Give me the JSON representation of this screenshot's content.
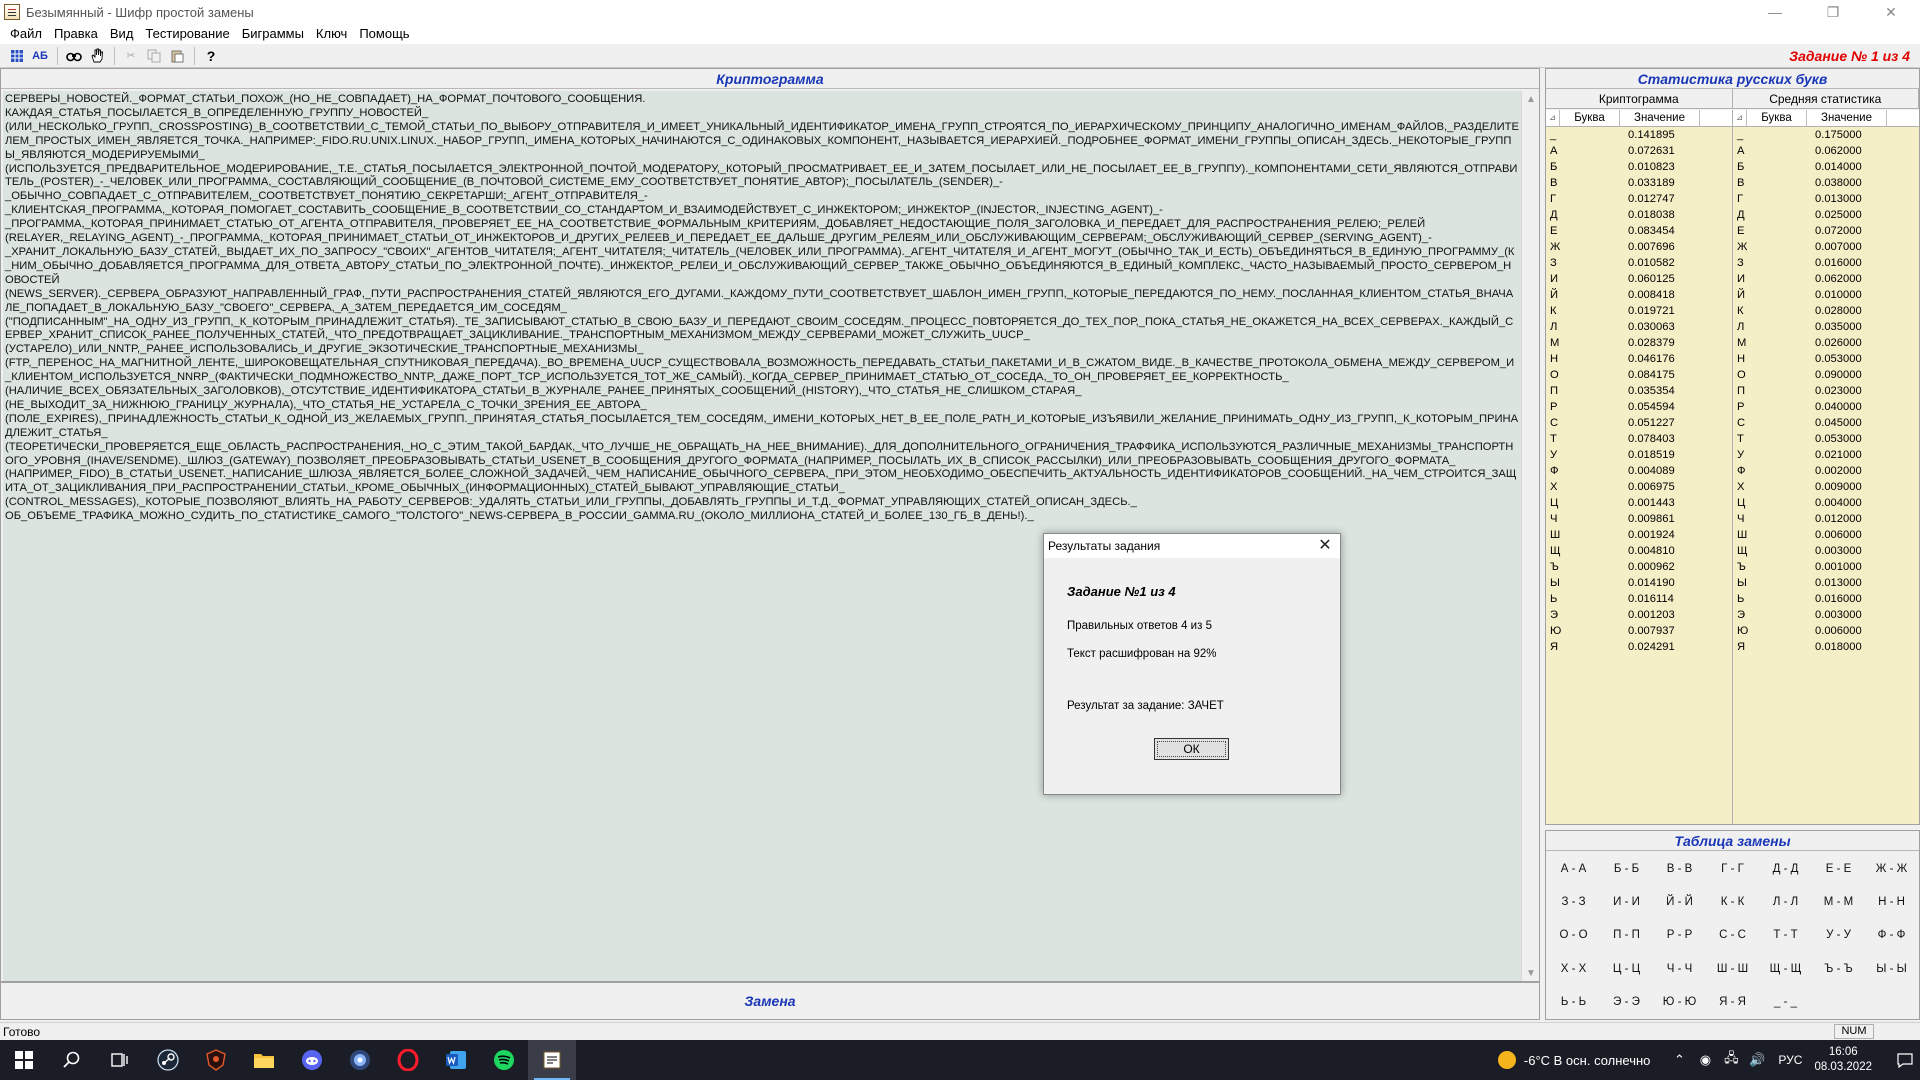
{
  "window": {
    "title": "Безымянный - Шифр простой замены",
    "controls": {
      "minimize": "—",
      "restore": "❐",
      "close": "✕"
    }
  },
  "menu": [
    "Файл",
    "Правка",
    "Вид",
    "Тестирование",
    "Биграммы",
    "Ключ",
    "Помощь"
  ],
  "toolbar": {
    "icons": [
      "grid-icon",
      "ab-icon",
      "binoculars-icon",
      "hand-icon",
      "cut-icon",
      "copy-icon",
      "paste-icon",
      "help-icon"
    ],
    "ab_label": "АБ",
    "help_label": "?"
  },
  "task_label": "Задание № 1 из 4",
  "cryptogram": {
    "header": "Криптограмма",
    "lines": [
      "СЕРВЕРЫ_НОВОСТЕЙ._ФОРМАТ_СТАТЬИ_ПОХОЖ_(НО_НЕ_СОВПАДАЕТ)_НА_ФОРМАТ_ПОЧТОВОГО_СООБЩЕНИЯ.",
      "КАЖДАЯ_СТАТЬЯ_ПОСЫЛАЕТСЯ_В_ОПРЕДЕЛЕННУЮ_ГРУППУ_НОВОСТЕЙ_",
      "(ИЛИ_НЕСКОЛЬКО_ГРУПП,_CROSSPOSTING)_В_СООТВЕТСТВИИ_С_ТЕМОЙ_СТАТЬИ_ПО_ВЫБОРУ_ОТПРАВИТЕЛЯ_И_ИМЕЕТ_УНИКАЛЬНЫЙ_ИДЕНТИФИКАТОР_ИМЕНА_ГРУПП_СТРОЯТСЯ_ПО_ИЕРАРХИЧЕСКОМУ_ПРИНЦИПУ_АНАЛОГИЧНО_ИМЕНАМ_ФАЙЛОВ,_РАЗДЕЛИТЕЛЕМ_ПРОСТЫХ_ИМЕН_ЯВЛЯЕТСЯ_ТОЧКА._НАПРИМЕР:_FIDO.RU.UNIX.LINUX._НАБОР_ГРУПП,_ИМЕНА_КОТОРЫХ_НАЧИНАЮТСЯ_С_ОДИНАКОВЫХ_КОМПОНЕНТ,_НАЗЫВАЕТСЯ_ИЕРАРХИЕЙ._ПОДРОБНЕЕ_ФОРМАТ_ИМЕНИ_ГРУППЫ_ОПИСАН_ЗДЕСЬ._НЕКОТОРЫЕ_ГРУППЫ_ЯВЛЯЮТСЯ_МОДЕРИРУЕМЫМИ_",
      "(ИСПОЛЬЗУЕТСЯ_ПРЕДВАРИТЕЛЬНОЕ_МОДЕРИРОВАНИЕ,_Т.Е._СТАТЬЯ_ПОСЫЛАЕТСЯ_ЭЛЕКТРОННОЙ_ПОЧТОЙ_МОДЕРАТОРУ,_КОТОРЫЙ_ПРОСМАТРИВАЕТ_ЕЕ_И_ЗАТЕМ_ПОСЫЛАЕТ_ИЛИ_НЕ_ПОСЫЛАЕТ_ЕЕ_В_ГРУППУ)._КОМПОНЕНТАМИ_СЕТИ_ЯВЛЯЮТСЯ_ОТПРАВИТЕЛЬ_(POSTER)_-_ЧЕЛОВЕК_ИЛИ_ПРОГРАММА,_СОСТАВЛЯЮЩИЙ_СООБЩЕНИЕ_(В_ПОЧТОВОЙ_СИСТЕМЕ_ЕМУ_СООТВЕТСТВУЕТ_ПОНЯТИЕ_АВТОР);_ПОСЫЛАТЕЛЬ_(SENDER)_-",
      "_ОБЫЧНО_СОВПАДАЕТ_С_ОТПРАВИТЕЛЕМ,_СООТВЕТСТВУЕТ_ПОНЯТИЮ_СЕКРЕТАРШИ;_АГЕНТ_ОТПРАВИТЕЛЯ_-",
      "_КЛИЕНТСКАЯ_ПРОГРАММА,_КОТОРАЯ_ПОМОГАЕТ_СОСТАВИТЬ_СООБЩЕНИЕ_В_СООТВЕТСТВИИ_СО_СТАНДАРТОМ_И_ВЗАИМОДЕЙСТВУЕТ_С_ИНЖЕКТОРОМ;_ИНЖЕКТОР_(INJECTOR,_INJECTING_AGENT)_-",
      "_ПРОГРАММА,_КОТОРАЯ_ПРИНИМАЕТ_СТАТЬЮ_ОТ_АГЕНТА_ОТПРАВИТЕЛЯ,_ПРОВЕРЯЕТ_ЕЕ_НА_СООТВЕТСТВИЕ_ФОРМАЛЬНЫМ_КРИТЕРИЯМ,_ДОБАВЛЯЕТ_НЕДОСТАЮЩИЕ_ПОЛЯ_ЗАГОЛОВКА_И_ПЕРЕДАЕТ_ДЛЯ_РАСПРОСТРАНЕНИЯ_РЕЛЕЮ;_РЕЛЕЙ",
      "(RELAYER,_RELAYING_AGENT)_-_ПРОГРАММА,_КОТОРАЯ_ПРИНИМАЕТ_СТАТЬИ_ОТ_ИНЖЕКТОРОВ_И_ДРУГИХ_РЕЛЕЕВ_И_ПЕРЕДАЕТ_ЕЕ_ДАЛЬШЕ_ДРУГИМ_РЕЛЕЯМ_ИЛИ_ОБСЛУЖИВАЮЩИМ_СЕРВЕРАМ;_ОБСЛУЖИВАЮЩИЙ_СЕРВЕР_(SERVING_AGENT)_-",
      "_ХРАНИТ_ЛОКАЛЬНУЮ_БАЗУ_СТАТЕЙ,_ВЫДАЕТ_ИХ_ПО_ЗАПРОСУ_\"СВОИХ\"_АГЕНТОВ_ЧИТАТЕЛЯ;_АГЕНТ_ЧИТАТЕЛЯ;_ЧИТАТЕЛЬ_(ЧЕЛОВЕК_ИЛИ_ПРОГРАММА)._АГЕНТ_ЧИТАТЕЛЯ_И_АГЕНТ_МОГУТ_(ОБЫЧНО_ТАК_И_ЕСТЬ)_ОБЪЕДИНЯТЬСЯ_В_ЕДИНУЮ_ПРОГРАММУ_(К_НИМ_ОБЫЧНО_ДОБАВЛЯЕТСЯ_ПРОГРАММА_ДЛЯ_ОТВЕТА_АВТОРУ_СТАТЬИ_ПО_ЭЛЕКТРОННОЙ_ПОЧТЕ)._ИНЖЕКТОР,_РЕЛЕИ_И_ОБСЛУЖИВАЮЩИЙ_СЕРВЕР_ТАКЖЕ_ОБЫЧНО_ОБЪЕДИНЯЮТСЯ_В_ЕДИНЫЙ_КОМПЛЕКС,_ЧАСТО_НАЗЫВАЕМЫЙ_ПРОСТО_СЕРВЕРОМ_НОВОСТЕЙ",
      "(NEWS_SERVER)._СЕРВЕРА_ОБРАЗУЮТ_НАПРАВЛЕННЫЙ_ГРАФ,_ПУТИ_РАСПРОСТРАНЕНИЯ_СТАТЕЙ_ЯВЛЯЮТСЯ_ЕГО_ДУГАМИ._КАЖДОМУ_ПУТИ_СООТВЕТСТВУЕТ_ШАБЛОН_ИМЕН_ГРУПП,_КОТОРЫЕ_ПЕРЕДАЮТСЯ_ПО_НЕМУ._ПОСЛАННАЯ_КЛИЕНТОМ_СТАТЬЯ_ВНАЧАЛЕ_ПОПАДАЕТ_В_ЛОКАЛЬНУЮ_БАЗУ_\"СВОЕГО\"_СЕРВЕРА,_А_ЗАТЕМ_ПЕРЕДАЕТСЯ_ИМ_СОСЕДЯМ_",
      "(\"ПОДПИСАННЫМ\"_НА_ОДНУ_ИЗ_ГРУПП,_К_КОТОРЫМ_ПРИНАДЛЕЖИТ_СТАТЬЯ)._ТЕ_ЗАПИСЫВАЮТ_СТАТЬЮ_В_СВОЮ_БАЗУ_И_ПЕРЕДАЮТ_СВОИМ_СОСЕДЯМ._ПРОЦЕСС_ПОВТОРЯЕТСЯ_ДО_ТЕХ_ПОР,_ПОКА_СТАТЬЯ_НЕ_ОКАЖЕТСЯ_НА_ВСЕХ_СЕРВЕРАХ._КАЖДЫЙ_СЕРВЕР_ХРАНИТ_СПИСОК_РАНЕЕ_ПОЛУЧЕННЫХ_СТАТЕЙ,_ЧТО_ПРЕДОТВРАЩАЕТ_ЗАЦИКЛИВАНИЕ._ТРАНСПОРТНЫМ_МЕХАНИЗМОМ_МЕЖДУ_СЕРВЕРАМИ_МОЖЕТ_СЛУЖИТЬ_UUCP_",
      "(УСТАРЕЛО)_ИЛИ_NNTP,_РАНЕЕ_ИСПОЛЬЗОВАЛИСЬ_И_ДРУГИЕ_ЭКЗОТИЧЕСКИЕ_ТРАНСПОРТНЫЕ_МЕХАНИЗМЫ_",
      "(FTP,_ПЕРЕНОС_НА_МАГНИТНОЙ_ЛЕНТЕ,_ШИРОКОВЕЩАТЕЛЬНАЯ_СПУТНИКОВАЯ_ПЕРЕДАЧА)._ВО_ВРЕМЕНА_UUCP_СУЩЕСТВОВАЛА_ВОЗМОЖНОСТЬ_ПЕРЕДАВАТЬ_СТАТЬИ_ПАКЕТАМИ_И_В_СЖАТОМ_ВИДЕ._В_КАЧЕСТВЕ_ПРОТОКОЛА_ОБМЕНА_МЕЖДУ_СЕРВЕРОМ_И_КЛИЕНТОМ_ИСПОЛЬЗУЕТСЯ_NNRP_(ФАКТИЧЕСКИ_ПОДМНОЖЕСТВО_NNTP,_ДАЖЕ_ПОРТ_TCP_ИСПОЛЬЗУЕТСЯ_ТОТ_ЖЕ_САМЫЙ)._КОГДА_СЕРВЕР_ПРИНИМАЕТ_СТАТЬЮ_ОТ_СОСЕДА,_ТО_ОН_ПРОВЕРЯЕТ_ЕЕ_КОРРЕКТНОСТЬ_",
      "(НАЛИЧИЕ_ВСЕХ_ОБЯЗАТЕЛЬНЫХ_ЗАГОЛОВКОВ),_ОТСУТСТВИЕ_ИДЕНТИФИКАТОРА_СТАТЬИ_В_ЖУРНАЛЕ_РАНЕЕ_ПРИНЯТЫХ_СООБЩЕНИЙ_(HISTORY),_ЧТО_СТАТЬЯ_НЕ_СЛИШКОМ_СТАРАЯ_",
      "(НЕ_ВЫХОДИТ_ЗА_НИЖНЮЮ_ГРАНИЦУ_ЖУРНАЛА),_ЧТО_СТАТЬЯ_НЕ_УСТАРЕЛА_С_ТОЧКИ_ЗРЕНИЯ_ЕЕ_АВТОРА_",
      "(ПОЛЕ_EXPIRES),_ПРИНАДЛЕЖНОСТЬ_СТАТЬИ_К_ОДНОЙ_ИЗ_ЖЕЛАЕМЫХ_ГРУПП._ПРИНЯТАЯ_СТАТЬЯ_ПОСЫЛАЕТСЯ_ТЕМ_СОСЕДЯМ,_ИМЕНИ_КОТОРЫХ_НЕТ_В_ЕЕ_ПОЛЕ_PATH_И_КОТОРЫЕ_ИЗЪЯВИЛИ_ЖЕЛАНИЕ_ПРИНИМАТЬ_ОДНУ_ИЗ_ГРУПП,_К_КОТОРЫМ_ПРИНАДЛЕЖИТ_СТАТЬЯ_",
      "(ТЕОРЕТИЧЕСКИ_ПРОВЕРЯЕТСЯ_ЕЩЕ_ОБЛАСТЬ_РАСПРОСТРАНЕНИЯ,_НО_С_ЭТИМ_ТАКОЙ_БАРДАК,_ЧТО_ЛУЧШЕ_НЕ_ОБРАЩАТЬ_НА_НЕЕ_ВНИМАНИЕ)._ДЛЯ_ДОПОЛНИТЕЛЬНОГО_ОГРАНИЧЕНИЯ_ТРАФФИКА_ИСПОЛЬЗУЮТСЯ_РАЗЛИЧНЫЕ_МЕХАНИЗМЫ_ТРАНСПОРТНОГО_УРОВНЯ_(IHAVE/SENDME)._ШЛЮЗ_(GATEWAY)_ПОЗВОЛЯЕТ_ПРЕОБРАЗОВЫВАТЬ_СТАТЬИ_USENET_В_СООБЩЕНИЯ_ДРУГОГО_ФОРМАТА_(НАПРИМЕР,_ПОСЫЛАТЬ_ИХ_В_СПИСОК_РАССЫЛКИ)_ИЛИ_ПРЕОБРАЗОВЫВАТЬ_СООБЩЕНИЯ_ДРУГОГО_ФОРМАТА_",
      "(НАПРИМЕР,_FIDO)_В_СТАТЬИ_USENET._НАПИСАНИЕ_ШЛЮЗА_ЯВЛЯЕТСЯ_БОЛЕЕ_СЛОЖНОЙ_ЗАДАЧЕЙ,_ЧЕМ_НАПИСАНИЕ_ОБЫЧНОГО_СЕРВЕРА,_ПРИ_ЭТОМ_НЕОБХОДИМО_ОБЕСПЕЧИТЬ_АКТУАЛЬНОСТЬ_ИДЕНТИФИКАТОРОВ_СООБЩЕНИЙ._НА_ЧЕМ_СТРОИТСЯ_ЗАЩИТА_ОТ_ЗАЦИКЛИВАНИЯ_ПРИ_РАСПРОСТРАНЕНИИ_СТАТЬИ._КРОМЕ_ОБЫЧНЫХ_(ИНФОРМАЦИОННЫХ)_СТАТЕЙ_БЫВАЮТ_УПРАВЛЯЮЩИЕ_СТАТЬИ_",
      "(CONTROL_MESSAGES),_КОТОРЫЕ_ПОЗВОЛЯЮТ_ВЛИЯТЬ_НА_РАБОТУ_СЕРВЕРОВ:_УДАЛЯТЬ_СТАТЬИ_ИЛИ_ГРУППЫ,_ДОБАВЛЯТЬ_ГРУППЫ_И_Т.Д._ФОРМАТ_УПРАВЛЯЮЩИХ_СТАТЕЙ_ОПИСАН_ЗДЕСЬ._",
      "ОБ_ОБЪЕМЕ_ТРАФИКА_МОЖНО_СУДИТЬ_ПО_СТАТИСТИКЕ_САМОГО_\"ТОЛСТОГО\"_NEWS-СЕРВЕРА_В_РОССИИ_GAMMA.RU_(ОКОЛО_МИЛЛИОНА_СТАТЕЙ_И_БОЛЕЕ_130_ГБ_В_ДЕНЬ!)._"
    ]
  },
  "zamena_label": "Замена",
  "stats": {
    "header": "Статистика русских букв",
    "left_title": "Криптограмма",
    "right_title": "Средняя статистика",
    "col_letter": "Буква",
    "col_value": "Значение",
    "cryptogram": [
      [
        "_",
        "0.141895"
      ],
      [
        "А",
        "0.072631"
      ],
      [
        "Б",
        "0.010823"
      ],
      [
        "В",
        "0.033189"
      ],
      [
        "Г",
        "0.012747"
      ],
      [
        "Д",
        "0.018038"
      ],
      [
        "Е",
        "0.083454"
      ],
      [
        "Ж",
        "0.007696"
      ],
      [
        "З",
        "0.010582"
      ],
      [
        "И",
        "0.060125"
      ],
      [
        "Й",
        "0.008418"
      ],
      [
        "К",
        "0.019721"
      ],
      [
        "Л",
        "0.030063"
      ],
      [
        "М",
        "0.028379"
      ],
      [
        "Н",
        "0.046176"
      ],
      [
        "О",
        "0.084175"
      ],
      [
        "П",
        "0.035354"
      ],
      [
        "Р",
        "0.054594"
      ],
      [
        "С",
        "0.051227"
      ],
      [
        "Т",
        "0.078403"
      ],
      [
        "У",
        "0.018519"
      ],
      [
        "Ф",
        "0.004089"
      ],
      [
        "Х",
        "0.006975"
      ],
      [
        "Ц",
        "0.001443"
      ],
      [
        "Ч",
        "0.009861"
      ],
      [
        "Ш",
        "0.001924"
      ],
      [
        "Щ",
        "0.004810"
      ],
      [
        "Ъ",
        "0.000962"
      ],
      [
        "Ы",
        "0.014190"
      ],
      [
        "Ь",
        "0.016114"
      ],
      [
        "Э",
        "0.001203"
      ],
      [
        "Ю",
        "0.007937"
      ],
      [
        "Я",
        "0.024291"
      ]
    ],
    "average": [
      [
        "_",
        "0.175000"
      ],
      [
        "А",
        "0.062000"
      ],
      [
        "Б",
        "0.014000"
      ],
      [
        "В",
        "0.038000"
      ],
      [
        "Г",
        "0.013000"
      ],
      [
        "Д",
        "0.025000"
      ],
      [
        "Е",
        "0.072000"
      ],
      [
        "Ж",
        "0.007000"
      ],
      [
        "З",
        "0.016000"
      ],
      [
        "И",
        "0.062000"
      ],
      [
        "Й",
        "0.010000"
      ],
      [
        "К",
        "0.028000"
      ],
      [
        "Л",
        "0.035000"
      ],
      [
        "М",
        "0.026000"
      ],
      [
        "Н",
        "0.053000"
      ],
      [
        "О",
        "0.090000"
      ],
      [
        "П",
        "0.023000"
      ],
      [
        "Р",
        "0.040000"
      ],
      [
        "С",
        "0.045000"
      ],
      [
        "Т",
        "0.053000"
      ],
      [
        "У",
        "0.021000"
      ],
      [
        "Ф",
        "0.002000"
      ],
      [
        "Х",
        "0.009000"
      ],
      [
        "Ц",
        "0.004000"
      ],
      [
        "Ч",
        "0.012000"
      ],
      [
        "Ш",
        "0.006000"
      ],
      [
        "Щ",
        "0.003000"
      ],
      [
        "Ъ",
        "0.001000"
      ],
      [
        "Ы",
        "0.013000"
      ],
      [
        "Ь",
        "0.016000"
      ],
      [
        "Э",
        "0.003000"
      ],
      [
        "Ю",
        "0.006000"
      ],
      [
        "Я",
        "0.018000"
      ]
    ]
  },
  "substitution": {
    "header": "Таблица замены",
    "pairs": [
      "А - А",
      "Б - Б",
      "В - В",
      "Г - Г",
      "Д - Д",
      "Е - Е",
      "Ж - Ж",
      "З - З",
      "И - И",
      "Й - Й",
      "К - К",
      "Л - Л",
      "М - М",
      "Н - Н",
      "О - О",
      "П - П",
      "Р - Р",
      "С - С",
      "Т - Т",
      "У - У",
      "Ф - Ф",
      "Х - Х",
      "Ц - Ц",
      "Ч - Ч",
      "Ш - Ш",
      "Щ - Щ",
      "Ъ - Ъ",
      "Ы - Ы",
      "Ь - Ь",
      "Э - Э",
      "Ю - Ю",
      "Я - Я",
      "_ - _",
      "",
      ""
    ]
  },
  "dialog": {
    "title": "Результаты задания",
    "heading": "Задание №1 из 4",
    "correct": "Правильных ответов 4 из 5",
    "decrypted": "Текст расшифрован на 92%",
    "result": "Результат за задание: ЗАЧЕТ",
    "ok": "ОК"
  },
  "statusbar": {
    "text": "Готово",
    "num": "NUM"
  },
  "taskbar": {
    "apps": [
      "windows-start-icon",
      "search-icon",
      "task-view-icon",
      "steam-icon",
      "shield-app-icon",
      "file-explorer-icon",
      "discord-icon",
      "browser-icon",
      "opera-icon",
      "word-icon",
      "spotify-icon",
      "cipher-app-icon"
    ],
    "weather": "-6°C  В осн. солнечно",
    "lang": "РУС",
    "time": "16:06",
    "date": "08.03.2022"
  },
  "colors": {
    "accent_blue": "#1a37b8",
    "task_red": "#e00000",
    "crypto_bg": "#dbe4df",
    "stats_bg": "#f5efc7"
  }
}
